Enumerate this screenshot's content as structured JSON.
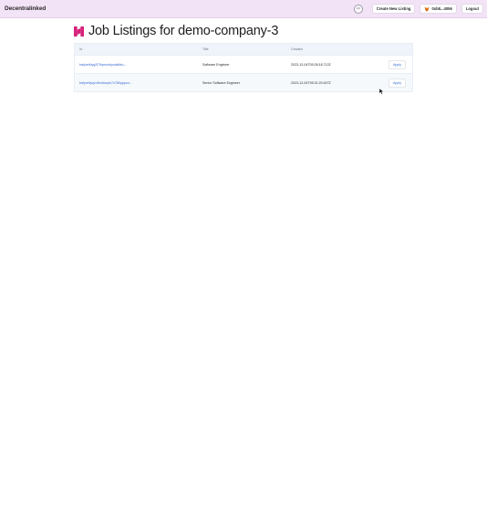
{
  "header": {
    "brand": "Decentralinked",
    "spinner_text": "100",
    "create_button": "Create New Listing",
    "wallet_button": "0xb8...4056",
    "logout_button": "Logout"
  },
  "page": {
    "title": "Job Listings for demo-company-3"
  },
  "table": {
    "columns": [
      "Id",
      "Title",
      "Created",
      ""
    ],
    "rows": [
      {
        "id": "bafyreiblyg2i7lfqmunbyoaktbtu...",
        "title": "Software Engineer",
        "created": "2023-12-04T05:28:18.712Z",
        "action": "Apply"
      },
      {
        "id": "bafyreifpqvn5nnbvqxk7v7i5hgqocz...",
        "title": "Senior Software Engineer",
        "created": "2023-12-04T05:31:20.627Z",
        "action": "Apply"
      }
    ]
  },
  "colors": {
    "header_bg": "#f3e3f6",
    "logo_accent": "#d6237a",
    "link": "#3b6fd4"
  }
}
